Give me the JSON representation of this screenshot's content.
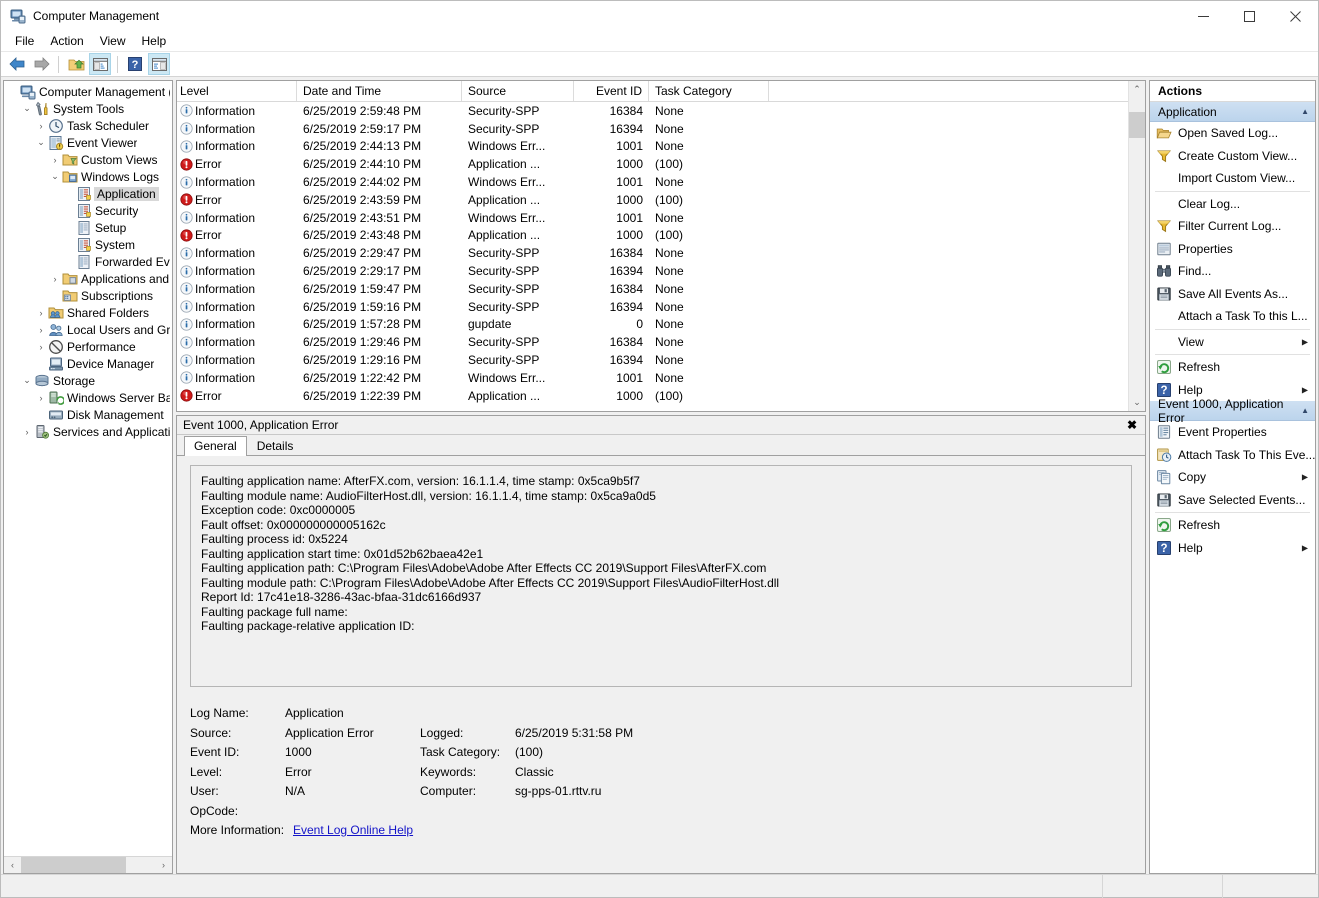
{
  "window": {
    "title": "Computer Management",
    "icon": "computer-management-icon",
    "minimize": "—",
    "maximize": "☐",
    "close": "✕"
  },
  "menubar": {
    "items": [
      "File",
      "Action",
      "View",
      "Help"
    ]
  },
  "toolbar": {
    "buttons": [
      {
        "name": "back-button",
        "icon": "arrow-left-icon",
        "selected": false
      },
      {
        "name": "forward-button",
        "icon": "arrow-right-icon",
        "selected": false
      },
      {
        "name": "up-one-level-button",
        "icon": "folder-up-icon",
        "selected": false
      },
      {
        "name": "show-hide-console-tree-button",
        "icon": "console-tree-icon",
        "selected": true
      },
      {
        "name": "help-button",
        "icon": "question-mark-icon",
        "selected": false
      },
      {
        "name": "show-hide-action-pane-button",
        "icon": "action-pane-icon",
        "selected": true
      }
    ]
  },
  "tree": {
    "nodes": [
      {
        "label": "Computer Management (Local",
        "depth": 0,
        "twist": "",
        "icon": "computer-icon",
        "selected": false
      },
      {
        "label": "System Tools",
        "depth": 1,
        "twist": "⌄",
        "icon": "system-tools-icon",
        "selected": false
      },
      {
        "label": "Task Scheduler",
        "depth": 2,
        "twist": "›",
        "icon": "task-scheduler-icon",
        "selected": false
      },
      {
        "label": "Event Viewer",
        "depth": 2,
        "twist": "⌄",
        "icon": "event-viewer-icon",
        "selected": false
      },
      {
        "label": "Custom Views",
        "depth": 3,
        "twist": "›",
        "icon": "custom-views-folder-icon",
        "selected": false
      },
      {
        "label": "Windows Logs",
        "depth": 3,
        "twist": "⌄",
        "icon": "windows-logs-folder-icon",
        "selected": false
      },
      {
        "label": "Application",
        "depth": 4,
        "twist": "",
        "icon": "log-icon",
        "selected": true
      },
      {
        "label": "Security",
        "depth": 4,
        "twist": "",
        "icon": "log-icon",
        "selected": false
      },
      {
        "label": "Setup",
        "depth": 4,
        "twist": "",
        "icon": "log-plain-icon",
        "selected": false
      },
      {
        "label": "System",
        "depth": 4,
        "twist": "",
        "icon": "log-icon",
        "selected": false
      },
      {
        "label": "Forwarded Event",
        "depth": 4,
        "twist": "",
        "icon": "log-plain-icon",
        "selected": false
      },
      {
        "label": "Applications and Se",
        "depth": 3,
        "twist": "›",
        "icon": "app-services-folder-icon",
        "selected": false
      },
      {
        "label": "Subscriptions",
        "depth": 3,
        "twist": "",
        "icon": "subscriptions-icon",
        "selected": false
      },
      {
        "label": "Shared Folders",
        "depth": 2,
        "twist": "›",
        "icon": "shared-folders-icon",
        "selected": false
      },
      {
        "label": "Local Users and Groups",
        "depth": 2,
        "twist": "›",
        "icon": "local-users-icon",
        "selected": false
      },
      {
        "label": "Performance",
        "depth": 2,
        "twist": "›",
        "icon": "performance-icon",
        "selected": false
      },
      {
        "label": "Device Manager",
        "depth": 2,
        "twist": "",
        "icon": "device-manager-icon",
        "selected": false
      },
      {
        "label": "Storage",
        "depth": 1,
        "twist": "⌄",
        "icon": "storage-icon",
        "selected": false
      },
      {
        "label": "Windows Server Backup",
        "depth": 2,
        "twist": "›",
        "icon": "server-backup-icon",
        "selected": false
      },
      {
        "label": "Disk Management",
        "depth": 2,
        "twist": "",
        "icon": "disk-management-icon",
        "selected": false
      },
      {
        "label": "Services and Applications",
        "depth": 1,
        "twist": "›",
        "icon": "services-apps-icon",
        "selected": false
      }
    ],
    "hscroll": {
      "left": "‹",
      "right": "›"
    }
  },
  "eventlist": {
    "columns": [
      "Level",
      "Date and Time",
      "Source",
      "Event ID",
      "Task Category"
    ],
    "rows": [
      {
        "level": "Information",
        "level_icon": "information-icon",
        "date": "6/25/2019 2:59:48 PM",
        "source": "Security-SPP",
        "event_id": "16384",
        "task": "None"
      },
      {
        "level": "Information",
        "level_icon": "information-icon",
        "date": "6/25/2019 2:59:17 PM",
        "source": "Security-SPP",
        "event_id": "16394",
        "task": "None"
      },
      {
        "level": "Information",
        "level_icon": "information-icon",
        "date": "6/25/2019 2:44:13 PM",
        "source": "Windows Err...",
        "event_id": "1001",
        "task": "None"
      },
      {
        "level": "Error",
        "level_icon": "error-icon",
        "date": "6/25/2019 2:44:10 PM",
        "source": "Application ...",
        "event_id": "1000",
        "task": "(100)"
      },
      {
        "level": "Information",
        "level_icon": "information-icon",
        "date": "6/25/2019 2:44:02 PM",
        "source": "Windows Err...",
        "event_id": "1001",
        "task": "None"
      },
      {
        "level": "Error",
        "level_icon": "error-icon",
        "date": "6/25/2019 2:43:59 PM",
        "source": "Application ...",
        "event_id": "1000",
        "task": "(100)"
      },
      {
        "level": "Information",
        "level_icon": "information-icon",
        "date": "6/25/2019 2:43:51 PM",
        "source": "Windows Err...",
        "event_id": "1001",
        "task": "None"
      },
      {
        "level": "Error",
        "level_icon": "error-icon",
        "date": "6/25/2019 2:43:48 PM",
        "source": "Application ...",
        "event_id": "1000",
        "task": "(100)"
      },
      {
        "level": "Information",
        "level_icon": "information-icon",
        "date": "6/25/2019 2:29:47 PM",
        "source": "Security-SPP",
        "event_id": "16384",
        "task": "None"
      },
      {
        "level": "Information",
        "level_icon": "information-icon",
        "date": "6/25/2019 2:29:17 PM",
        "source": "Security-SPP",
        "event_id": "16394",
        "task": "None"
      },
      {
        "level": "Information",
        "level_icon": "information-icon",
        "date": "6/25/2019 1:59:47 PM",
        "source": "Security-SPP",
        "event_id": "16384",
        "task": "None"
      },
      {
        "level": "Information",
        "level_icon": "information-icon",
        "date": "6/25/2019 1:59:16 PM",
        "source": "Security-SPP",
        "event_id": "16394",
        "task": "None"
      },
      {
        "level": "Information",
        "level_icon": "information-icon",
        "date": "6/25/2019 1:57:28 PM",
        "source": "gupdate",
        "event_id": "0",
        "task": "None"
      },
      {
        "level": "Information",
        "level_icon": "information-icon",
        "date": "6/25/2019 1:29:46 PM",
        "source": "Security-SPP",
        "event_id": "16384",
        "task": "None"
      },
      {
        "level": "Information",
        "level_icon": "information-icon",
        "date": "6/25/2019 1:29:16 PM",
        "source": "Security-SPP",
        "event_id": "16394",
        "task": "None"
      },
      {
        "level": "Information",
        "level_icon": "information-icon",
        "date": "6/25/2019 1:22:42 PM",
        "source": "Windows Err...",
        "event_id": "1001",
        "task": "None"
      },
      {
        "level": "Error",
        "level_icon": "error-icon",
        "date": "6/25/2019 1:22:39 PM",
        "source": "Application ...",
        "event_id": "1000",
        "task": "(100)"
      }
    ],
    "scroll": {
      "up": "⌃",
      "down": "⌄"
    }
  },
  "details": {
    "title": "Event 1000, Application Error",
    "close": "✖",
    "tabs": [
      {
        "label": "General",
        "active": true
      },
      {
        "label": "Details",
        "active": false
      }
    ],
    "description_lines": [
      "Faulting application name: AfterFX.com, version: 16.1.1.4, time stamp: 0x5ca9b5f7",
      "Faulting module name: AudioFilterHost.dll, version: 16.1.1.4, time stamp: 0x5ca9a0d5",
      "Exception code: 0xc0000005",
      "Fault offset: 0x000000000005162c",
      "Faulting process id: 0x5224",
      "Faulting application start time: 0x01d52b62baea42e1",
      "Faulting application path: C:\\Program Files\\Adobe\\Adobe After Effects CC 2019\\Support Files\\AfterFX.com",
      "Faulting module path: C:\\Program Files\\Adobe\\Adobe After Effects CC 2019\\Support Files\\AudioFilterHost.dll",
      "Report Id: 17c41e18-3286-43ac-bfaa-31dc6166d937",
      "Faulting package full name:",
      "Faulting package-relative application ID:"
    ],
    "meta": {
      "log_name_label": "Log Name:",
      "log_name_value": "Application",
      "source_label": "Source:",
      "source_value": "Application Error",
      "logged_label": "Logged:",
      "logged_value": "6/25/2019 5:31:58 PM",
      "event_id_label": "Event ID:",
      "event_id_value": "1000",
      "task_category_label": "Task Category:",
      "task_category_value": "(100)",
      "level_label": "Level:",
      "level_value": "Error",
      "keywords_label": "Keywords:",
      "keywords_value": "Classic",
      "user_label": "User:",
      "user_value": "N/A",
      "computer_label": "Computer:",
      "computer_value": "sg-pps-01.rttv.ru",
      "opcode_label": "OpCode:",
      "opcode_value": "",
      "more_info_label": "More Information:",
      "more_info_link": "Event Log Online Help"
    }
  },
  "actions": {
    "title": "Actions",
    "sections": [
      {
        "header": "Application",
        "caret": "▲",
        "items": [
          {
            "label": "Open Saved Log...",
            "icon": "open-folder-icon",
            "submenu": false,
            "sep_after": false
          },
          {
            "label": "Create Custom View...",
            "icon": "filter-funnel-icon",
            "submenu": false,
            "sep_after": false
          },
          {
            "label": "Import Custom View...",
            "icon": "",
            "submenu": false,
            "sep_after": true
          },
          {
            "label": "Clear Log...",
            "icon": "",
            "submenu": false,
            "sep_after": false
          },
          {
            "label": "Filter Current Log...",
            "icon": "filter-funnel-icon",
            "submenu": false,
            "sep_after": false
          },
          {
            "label": "Properties",
            "icon": "properties-icon",
            "submenu": false,
            "sep_after": false
          },
          {
            "label": "Find...",
            "icon": "find-binoculars-icon",
            "submenu": false,
            "sep_after": false
          },
          {
            "label": "Save All Events As...",
            "icon": "save-disk-icon",
            "submenu": false,
            "sep_after": false
          },
          {
            "label": "Attach a Task To this L...",
            "icon": "",
            "submenu": false,
            "sep_after": true
          },
          {
            "label": "View",
            "icon": "",
            "submenu": true,
            "sep_after": true
          },
          {
            "label": "Refresh",
            "icon": "refresh-icon",
            "submenu": false,
            "sep_after": false
          },
          {
            "label": "Help",
            "icon": "help-icon",
            "submenu": true,
            "sep_after": false
          }
        ]
      },
      {
        "header": "Event 1000, Application Error",
        "caret": "▲",
        "items": [
          {
            "label": "Event Properties",
            "icon": "event-properties-icon",
            "submenu": false,
            "sep_after": false
          },
          {
            "label": "Attach Task To This Eve...",
            "icon": "attach-task-icon",
            "submenu": false,
            "sep_after": false
          },
          {
            "label": "Copy",
            "icon": "copy-icon",
            "submenu": true,
            "sep_after": false
          },
          {
            "label": "Save Selected Events...",
            "icon": "save-disk-icon",
            "submenu": false,
            "sep_after": true
          },
          {
            "label": "Refresh",
            "icon": "refresh-icon",
            "submenu": false,
            "sep_after": false
          },
          {
            "label": "Help",
            "icon": "help-icon",
            "submenu": true,
            "sep_after": false
          }
        ]
      }
    ],
    "submenu_arrow": "▶"
  },
  "statusbar": {
    "panel1": "",
    "panel2": "",
    "panel3": ""
  },
  "colors": {
    "accent": "#bcd4ec",
    "error": "#cc0000",
    "info": "#3a7ebf",
    "link": "#1414c8",
    "selection": "#d8d8d8"
  }
}
